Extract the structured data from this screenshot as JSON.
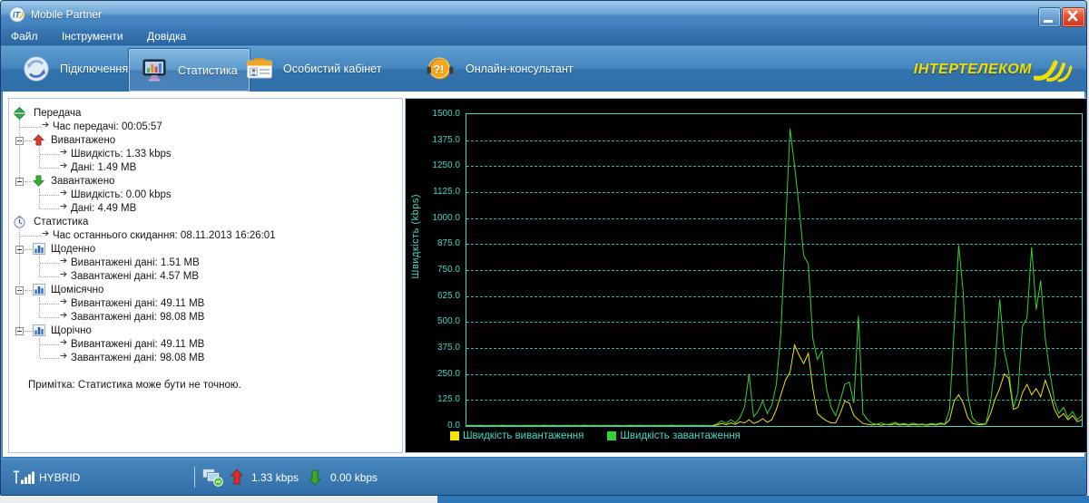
{
  "window": {
    "title": "Mobile Partner"
  },
  "menu": {
    "items": [
      "Файл",
      "Інструменти",
      "Довідка"
    ]
  },
  "toolbar": {
    "buttons": [
      {
        "label": "Підключення",
        "icon": "connection-icon",
        "selected": false
      },
      {
        "label": "Статистика",
        "icon": "statistics-icon",
        "selected": true
      },
      {
        "label": "Особистий кабінет",
        "icon": "id-card-icon",
        "selected": false
      },
      {
        "label": "Онлайн-консультант",
        "icon": "consultant-icon",
        "selected": false
      }
    ],
    "brand": "ІНТЕРТЕЛЕКОМ"
  },
  "tree": {
    "items": [
      {
        "level": 0,
        "icon": "transfer",
        "label": "Передача"
      },
      {
        "level": 1,
        "icon": "bullet",
        "label": "Час передачі: 00:05:57"
      },
      {
        "level": 1,
        "icon": "upload",
        "expander": true,
        "label": "Вивантажено"
      },
      {
        "level": 2,
        "icon": "bullet",
        "label": "Швидкість: 1.33 kbps"
      },
      {
        "level": 2,
        "icon": "bullet",
        "label": "Дані: 1.49 MB"
      },
      {
        "level": 1,
        "icon": "download",
        "expander": true,
        "label": "Завантажено"
      },
      {
        "level": 2,
        "icon": "bullet",
        "label": "Швидкість: 0.00 kbps"
      },
      {
        "level": 2,
        "icon": "bullet",
        "label": "Дані: 4.49 MB"
      },
      {
        "level": 0,
        "icon": "clock",
        "label": "Статистика"
      },
      {
        "level": 1,
        "icon": "bullet",
        "label": "Час останнього скидання: 08.11.2013 16:26:01"
      },
      {
        "level": 1,
        "icon": "chart",
        "expander": true,
        "label": "Щоденно"
      },
      {
        "level": 2,
        "icon": "bullet",
        "label": "Вивантажені дані: 1.51 MB"
      },
      {
        "level": 2,
        "icon": "bullet",
        "label": "Завантажені дані: 4.57 MB"
      },
      {
        "level": 1,
        "icon": "chart",
        "expander": true,
        "label": "Щомісячно"
      },
      {
        "level": 2,
        "icon": "bullet",
        "label": "Вивантажені дані: 49.11 MB"
      },
      {
        "level": 2,
        "icon": "bullet",
        "label": "Завантажені дані: 98.08 MB"
      },
      {
        "level": 1,
        "icon": "chart",
        "expander": true,
        "label": "Щорічно"
      },
      {
        "level": 2,
        "icon": "bullet",
        "label": "Вивантажені дані: 49.11 MB"
      },
      {
        "level": 2,
        "icon": "bullet",
        "label": "Завантажені дані: 98.08 MB"
      }
    ],
    "note": "Примітка: Статистика може бути не точною."
  },
  "statusbar": {
    "network_mode": "HYBRID",
    "upload_speed": "1.33 kbps",
    "download_speed": "0.00 kbps",
    "upload_arrow_color": "#d93028",
    "download_arrow_color": "#3da72a"
  },
  "chart_data": {
    "type": "line",
    "title": "",
    "xlabel": "",
    "ylabel": "Швидкість (kbps)",
    "ylim": [
      0,
      1500
    ],
    "ytick_step": 125,
    "yticks": [
      "1500.0",
      "1375.0",
      "1250.0",
      "1125.0",
      "1000.0",
      "875.0",
      "750.0",
      "625.0",
      "500.0",
      "375.0",
      "250.0",
      "125.0",
      "0.0"
    ],
    "grid": "horizontal-dashed",
    "legend_position": "bottom",
    "background": "#000000",
    "axis_color": "#3fd8c8",
    "series": [
      {
        "name": "Швидкість вивантаження",
        "color": "#f0e400",
        "values": [
          1,
          1,
          2,
          1,
          1,
          1,
          2,
          1,
          1,
          1,
          1,
          2,
          1,
          1,
          1,
          2,
          1,
          1,
          1,
          1,
          2,
          1,
          1,
          1,
          2,
          1,
          1,
          1,
          1,
          2,
          1,
          1,
          1,
          2,
          1,
          1,
          1,
          1,
          2,
          1,
          1,
          1,
          2,
          1,
          1,
          1,
          1,
          2,
          1,
          1,
          1,
          2,
          1,
          1,
          1,
          5,
          12,
          6,
          15,
          8,
          20,
          15,
          30,
          12,
          20,
          35,
          18,
          30,
          80,
          150,
          220,
          260,
          390,
          340,
          300,
          350,
          180,
          60,
          40,
          25,
          15,
          15,
          60,
          120,
          110,
          50,
          30,
          12,
          8,
          5,
          8,
          4,
          8,
          5,
          10,
          5,
          8,
          4,
          8,
          5,
          8,
          4,
          8,
          5,
          10,
          8,
          30,
          120,
          150,
          110,
          40,
          12,
          8,
          6,
          10,
          60,
          130,
          180,
          250,
          230,
          80,
          90,
          160,
          200,
          150,
          180,
          140,
          220,
          160,
          80,
          40,
          60,
          30,
          50,
          20,
          30
        ]
      },
      {
        "name": "Швидкість завантаження",
        "color": "#35d235",
        "values": [
          2,
          3,
          2,
          3,
          2,
          2,
          3,
          2,
          4,
          2,
          3,
          2,
          2,
          3,
          2,
          3,
          2,
          4,
          2,
          3,
          2,
          2,
          3,
          2,
          3,
          2,
          4,
          2,
          3,
          2,
          2,
          3,
          2,
          3,
          2,
          2,
          4,
          2,
          3,
          2,
          2,
          3,
          2,
          3,
          2,
          4,
          2,
          3,
          2,
          2,
          3,
          2,
          3,
          2,
          2,
          10,
          25,
          12,
          30,
          15,
          40,
          90,
          250,
          45,
          70,
          120,
          60,
          100,
          200,
          450,
          950,
          1430,
          1250,
          1050,
          820,
          780,
          420,
          320,
          360,
          180,
          90,
          50,
          120,
          200,
          210,
          110,
          530,
          60,
          30,
          12,
          8,
          15,
          6,
          10,
          18,
          8,
          12,
          6,
          14,
          8,
          10,
          6,
          12,
          8,
          15,
          10,
          80,
          470,
          870,
          640,
          150,
          40,
          15,
          10,
          12,
          120,
          300,
          610,
          360,
          260,
          90,
          160,
          480,
          520,
          860,
          560,
          700,
          420,
          260,
          120,
          60,
          90,
          40,
          70,
          30,
          50
        ]
      }
    ]
  }
}
